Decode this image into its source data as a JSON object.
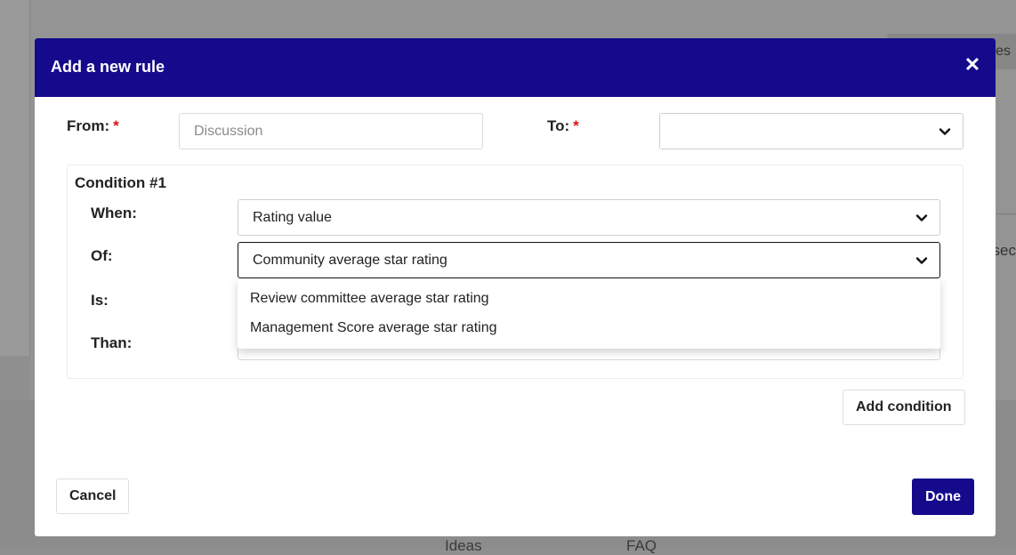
{
  "background": {
    "tab_fragment": "es",
    "side_fragment": "sec",
    "footer_ideas": "Ideas",
    "footer_faq": "FAQ"
  },
  "modal": {
    "title": "Add a new rule",
    "close_icon": "close-icon",
    "accent_color": "#150a8c",
    "from": {
      "label": "From:",
      "required": "*",
      "placeholder": "Discussion",
      "value": ""
    },
    "to": {
      "label": "To:",
      "required": "*",
      "value": ""
    },
    "condition": {
      "title": "Condition #1",
      "when": {
        "label": "When:",
        "value": "Rating value"
      },
      "of": {
        "label": "Of:",
        "value": "Community average star rating",
        "options": [
          "Review committee average star rating",
          "Management Score average star rating"
        ]
      },
      "is": {
        "label": "Is:"
      },
      "than": {
        "label": "Than:"
      }
    },
    "add_condition_label": "Add condition",
    "cancel_label": "Cancel",
    "done_label": "Done"
  }
}
